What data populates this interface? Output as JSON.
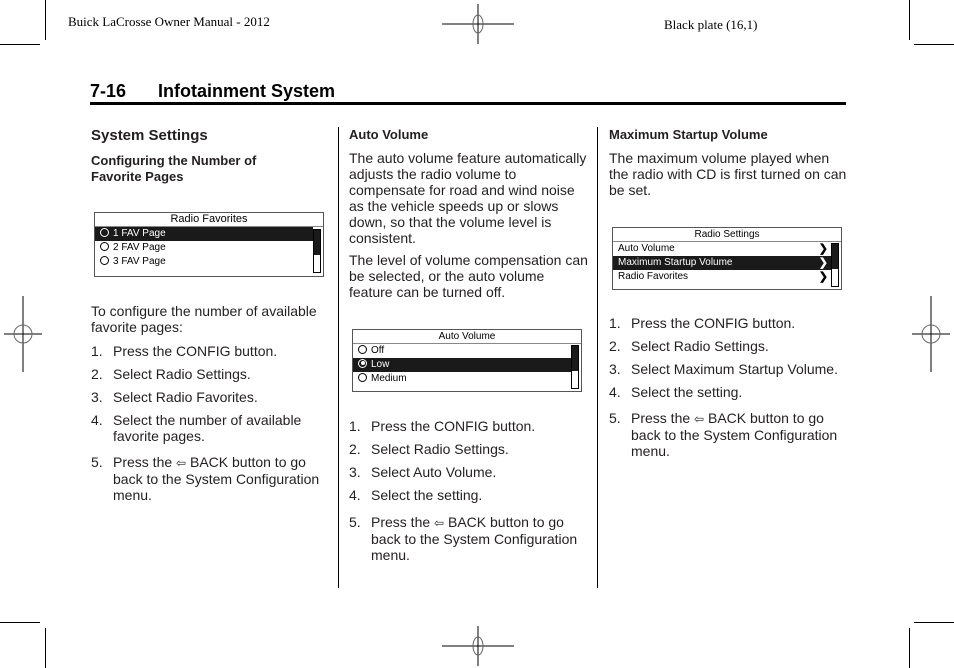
{
  "header": {
    "doc_title": "Buick LaCrosse Owner Manual - 2012",
    "plate": "Black plate (16,1)"
  },
  "chapter": {
    "number": "7-16",
    "title": "Infotainment System"
  },
  "col1": {
    "heading": "System Settings",
    "subheading": "Configuring the Number of Favorite Pages",
    "screen": {
      "title": "Radio Favorites",
      "items": [
        {
          "label": "1 FAV Page",
          "selected": true
        },
        {
          "label": "2 FAV Page",
          "selected": false
        },
        {
          "label": "3 FAV Page",
          "selected": false
        }
      ],
      "scroll_position": 0.6
    },
    "intro": "To configure the number of available favorite pages:",
    "steps": [
      {
        "n": "1.",
        "text": "Press the CONFIG button."
      },
      {
        "n": "2.",
        "text": "Select Radio Settings."
      },
      {
        "n": "3.",
        "text": "Select Radio Favorites."
      },
      {
        "n": "4.",
        "text": "Select the number of available favorite pages."
      }
    ],
    "step5": {
      "n": "5.",
      "pre": "Press the",
      "icon": "back-arrow-icon",
      "glyph": "⇦",
      "post": "BACK button to go back to the System Configuration menu."
    }
  },
  "col2": {
    "heading": "Auto Volume",
    "para1": "The auto volume feature automatically adjusts the radio volume to compensate for road and wind noise as the vehicle speeds up or slows down, so that the volume level is consistent.",
    "para2": "The level of volume compensation can be selected, or the auto volume feature can be turned off.",
    "screen": {
      "title": "Auto Volume",
      "items": [
        {
          "label": "Off",
          "selected": false
        },
        {
          "label": "Low",
          "selected": true
        },
        {
          "label": "Medium",
          "selected": false
        }
      ],
      "scroll_position": 0.6
    },
    "steps": [
      {
        "n": "1.",
        "text": "Press the CONFIG button."
      },
      {
        "n": "2.",
        "text": "Select Radio Settings."
      },
      {
        "n": "3.",
        "text": "Select Auto Volume."
      },
      {
        "n": "4.",
        "text": "Select the setting."
      }
    ],
    "step5": {
      "n": "5.",
      "pre": "Press the",
      "icon": "back-arrow-icon",
      "glyph": "⇦",
      "post": "BACK button to go back to the System Configuration menu."
    }
  },
  "col3": {
    "heading": "Maximum Startup Volume",
    "para1": "The maximum volume played when the radio with CD is first turned on can be set.",
    "screen": {
      "title": "Radio Settings",
      "items": [
        {
          "label": "Auto Volume",
          "selected": false
        },
        {
          "label": "Maximum Startup Volume",
          "selected": true
        },
        {
          "label": "Radio Favorites",
          "selected": false
        }
      ],
      "chevron": "❯",
      "scroll_position": 0.6
    },
    "steps": [
      {
        "n": "1.",
        "text": "Press the CONFIG button."
      },
      {
        "n": "2.",
        "text": "Select Radio Settings."
      },
      {
        "n": "3.",
        "text": "Select Maximum Startup Volume."
      },
      {
        "n": "4.",
        "text": "Select the setting."
      }
    ],
    "step5": {
      "n": "5.",
      "pre": "Press the",
      "icon": "back-arrow-icon",
      "glyph": "⇦",
      "post": "BACK button to go back to the System Configuration menu."
    }
  }
}
